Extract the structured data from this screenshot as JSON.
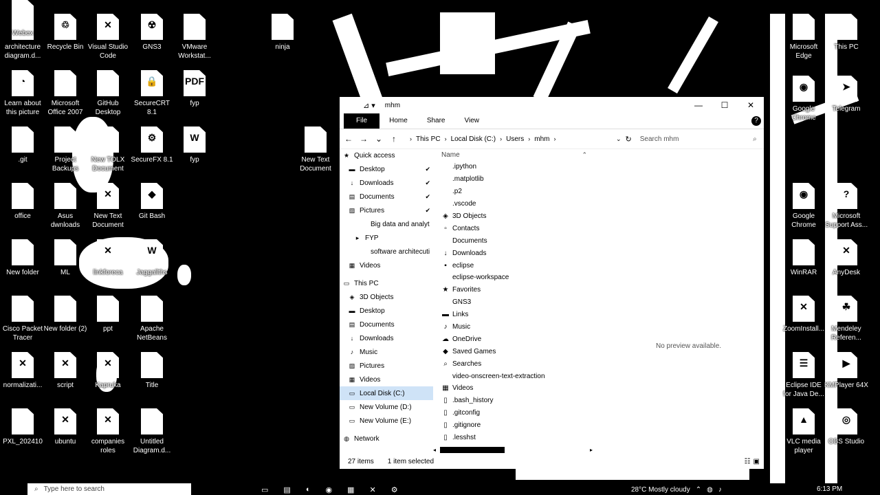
{
  "desktop": {
    "icons": [
      {
        "label": "architecture diagram.d...",
        "glyph": ""
      },
      {
        "label": "Recycle Bin",
        "glyph": "♲"
      },
      {
        "label": "Visual Studio Code",
        "glyph": "✕"
      },
      {
        "label": "GNS3",
        "glyph": "☢"
      },
      {
        "label": "VMware Workstat...",
        "glyph": ""
      },
      {
        "label": "ninja",
        "glyph": ""
      },
      {
        "label": "Learn about this picture",
        "glyph": "◔"
      },
      {
        "label": "Microsoft Office 2007",
        "glyph": ""
      },
      {
        "label": "GitHub Desktop",
        "glyph": ""
      },
      {
        "label": "SecureCRT 8.1",
        "glyph": "🔒"
      },
      {
        "label": "fyp",
        "glyph": "PDF"
      },
      {
        "label": ".git",
        "glyph": ""
      },
      {
        "label": "Project Backups",
        "glyph": ""
      },
      {
        "label": "New TOLX Document",
        "glyph": ""
      },
      {
        "label": "SecureFX 8.1",
        "glyph": "⚙"
      },
      {
        "label": "fyp",
        "glyph": "W"
      },
      {
        "label": "New Text Document",
        "glyph": ""
      },
      {
        "label": "office",
        "glyph": ""
      },
      {
        "label": "Asus dwnloads",
        "glyph": ""
      },
      {
        "label": "New Text Document",
        "glyph": "✕"
      },
      {
        "label": "Git Bash",
        "glyph": "◆"
      },
      {
        "label": "New folder",
        "glyph": ""
      },
      {
        "label": "ML",
        "glyph": ""
      },
      {
        "label": "linkforeca",
        "glyph": "✕"
      },
      {
        "label": "Jaggallths",
        "glyph": "W"
      },
      {
        "label": "Cisco Packet Tracer",
        "glyph": ""
      },
      {
        "label": "New folder (2)",
        "glyph": ""
      },
      {
        "label": "ppt",
        "glyph": ""
      },
      {
        "label": "Apache NetBeans",
        "glyph": ""
      },
      {
        "label": "normalizati...",
        "glyph": "✕"
      },
      {
        "label": "script",
        "glyph": "✕"
      },
      {
        "label": "Kapruka",
        "glyph": "✕"
      },
      {
        "label": "Title",
        "glyph": ""
      },
      {
        "label": "PXL_202410",
        "glyph": ""
      },
      {
        "label": "ubuntu",
        "glyph": "✕"
      },
      {
        "label": "companies roles",
        "glyph": "✕"
      },
      {
        "label": "Untitled Diagram.d...",
        "glyph": ""
      },
      {
        "label": "Microsoft Edge",
        "glyph": ""
      },
      {
        "label": "This PC",
        "glyph": ""
      },
      {
        "label": "Google Chrome",
        "glyph": "◉"
      },
      {
        "label": "Telegram",
        "glyph": "➤"
      },
      {
        "label": "Google Chrome",
        "glyph": "◉"
      },
      {
        "label": "Microsoft Support Ass...",
        "glyph": "?"
      },
      {
        "label": "WinRAR",
        "glyph": ""
      },
      {
        "label": "AnyDesk",
        "glyph": "✕"
      },
      {
        "label": "ZoomInstall...",
        "glyph": "✕"
      },
      {
        "label": "Mendeley Referen...",
        "glyph": "☘"
      },
      {
        "label": "Eclipse IDE for Java De...",
        "glyph": "☰"
      },
      {
        "label": "KMPlayer 64X",
        "glyph": "▶"
      },
      {
        "label": "VLC media player",
        "glyph": "▲"
      },
      {
        "label": "OBS Studio",
        "glyph": "◎"
      },
      {
        "label": "Webex",
        "glyph": ""
      }
    ]
  },
  "window": {
    "title": "mhm",
    "ribbon_tabs": [
      "File",
      "Home",
      "Share",
      "View"
    ],
    "help_glyph": "?",
    "controls": {
      "minimize": "—",
      "maximize": "☐",
      "close": "✕"
    },
    "nav": {
      "back": "←",
      "forward": "→",
      "recent": "⌄",
      "up": "↑"
    },
    "breadcrumb": [
      "This PC",
      "Local Disk (C:)",
      "Users",
      "mhm"
    ],
    "breadcrumb_sep": "›",
    "search_placeholder": "Search mhm",
    "nav_pane": [
      {
        "label": "Quick access",
        "icon": "★",
        "pin": ""
      },
      {
        "label": "Desktop",
        "icon": "▬",
        "pin": "✔"
      },
      {
        "label": "Downloads",
        "icon": "↓",
        "pin": "✔"
      },
      {
        "label": "Documents",
        "icon": "▤",
        "pin": "✔"
      },
      {
        "label": "Pictures",
        "icon": "▨",
        "pin": "✔"
      },
      {
        "label": "Big data and analyt",
        "icon": "",
        "pin": ""
      },
      {
        "label": "FYP",
        "icon": "▸",
        "pin": ""
      },
      {
        "label": "software architecuti",
        "icon": "",
        "pin": ""
      },
      {
        "label": "Videos",
        "icon": "▦",
        "pin": ""
      },
      {
        "label": "This PC",
        "icon": "▭",
        "pin": ""
      },
      {
        "label": "3D Objects",
        "icon": "◈",
        "pin": ""
      },
      {
        "label": "Desktop",
        "icon": "▬",
        "pin": ""
      },
      {
        "label": "Documents",
        "icon": "▤",
        "pin": ""
      },
      {
        "label": "Downloads",
        "icon": "↓",
        "pin": ""
      },
      {
        "label": "Music",
        "icon": "♪",
        "pin": ""
      },
      {
        "label": "Pictures",
        "icon": "▨",
        "pin": ""
      },
      {
        "label": "Videos",
        "icon": "▦",
        "pin": ""
      },
      {
        "label": "Local Disk (C:)",
        "icon": "▭",
        "pin": ""
      },
      {
        "label": "New Volume (D:)",
        "icon": "▭",
        "pin": ""
      },
      {
        "label": "New Volume (E:)",
        "icon": "▭",
        "pin": ""
      },
      {
        "label": "Network",
        "icon": "◍",
        "pin": ""
      }
    ],
    "column_name": "Name",
    "sort_glyph": "⌃",
    "files": [
      {
        "name": ".ipython",
        "icon": ""
      },
      {
        "name": ".matplotlib",
        "icon": ""
      },
      {
        "name": ".p2",
        "icon": ""
      },
      {
        "name": ".vscode",
        "icon": ""
      },
      {
        "name": "3D Objects",
        "icon": "◈"
      },
      {
        "name": "Contacts",
        "icon": "▫"
      },
      {
        "name": "Documents",
        "icon": ""
      },
      {
        "name": "Downloads",
        "icon": "↓"
      },
      {
        "name": "eclipse",
        "icon": "▪"
      },
      {
        "name": "eclipse-workspace",
        "icon": ""
      },
      {
        "name": "Favorites",
        "icon": "★"
      },
      {
        "name": "GNS3",
        "icon": ""
      },
      {
        "name": "Links",
        "icon": "▬"
      },
      {
        "name": "Music",
        "icon": "♪"
      },
      {
        "name": "OneDrive",
        "icon": "☁"
      },
      {
        "name": "Saved Games",
        "icon": "◆"
      },
      {
        "name": "Searches",
        "icon": "⌕"
      },
      {
        "name": "video-onscreen-text-extraction",
        "icon": ""
      },
      {
        "name": "Videos",
        "icon": "▦"
      },
      {
        "name": ".bash_history",
        "icon": "▯"
      },
      {
        "name": ".gitconfig",
        "icon": "▯"
      },
      {
        "name": ".gitignore",
        "icon": "▯"
      },
      {
        "name": ".lesshst",
        "icon": "▯"
      }
    ],
    "preview_text": "No preview available.",
    "status_count": "27 items",
    "status_selected": "1 item selected"
  },
  "taskbar": {
    "search_placeholder": "Type here to search",
    "weather": "28°C  Mostly cloudy",
    "clock": "6:13 PM"
  }
}
